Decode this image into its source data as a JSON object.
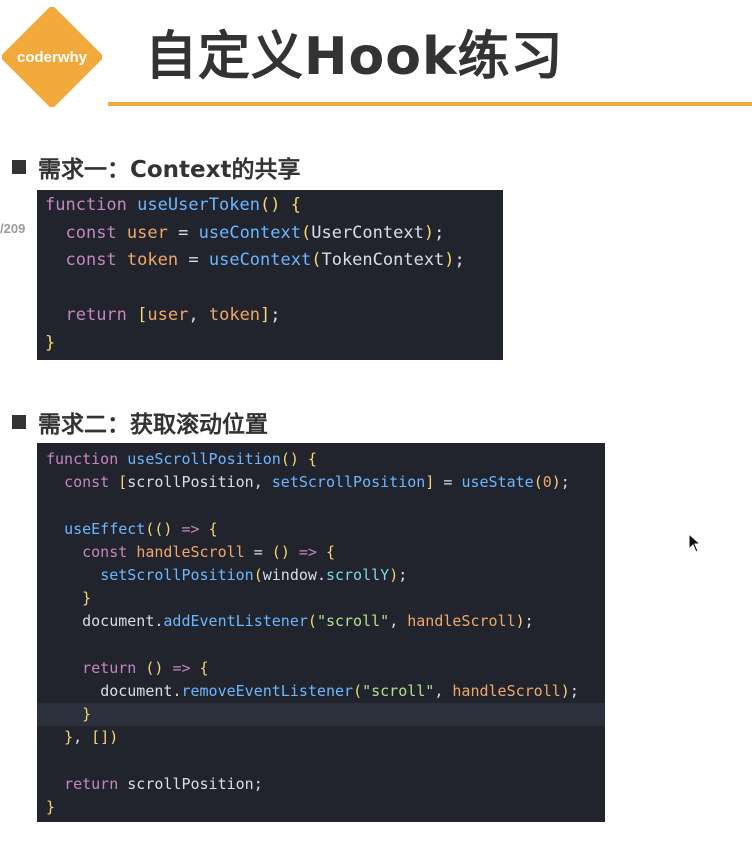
{
  "header": {
    "logo_text": "coderwhy",
    "title": "自定义Hook练习",
    "brand_color": "#f2a93b"
  },
  "page_number": "/209",
  "requirement1": {
    "heading": "需求一：Context的共享",
    "code_lines": [
      "function useUserToken() {",
      "  const user = useContext(UserContext);",
      "  const token = useContext(TokenContext);",
      "",
      "  return [user, token];",
      "}"
    ]
  },
  "requirement2": {
    "heading": "需求二：获取滚动位置",
    "code_lines": [
      "function useScrollPosition() {",
      "  const [scrollPosition, setScrollPosition] = useState(0);",
      "",
      "  useEffect(() => {",
      "    const handleScroll = () => {",
      "      setScrollPosition(window.scrollY);",
      "    }",
      "    document.addEventListener(\"scroll\", handleScroll);",
      "",
      "    return () => {",
      "      document.removeEventListener(\"scroll\", handleScroll);",
      "    }",
      "  }, [])",
      "",
      "  return scrollPosition;",
      "}"
    ]
  }
}
